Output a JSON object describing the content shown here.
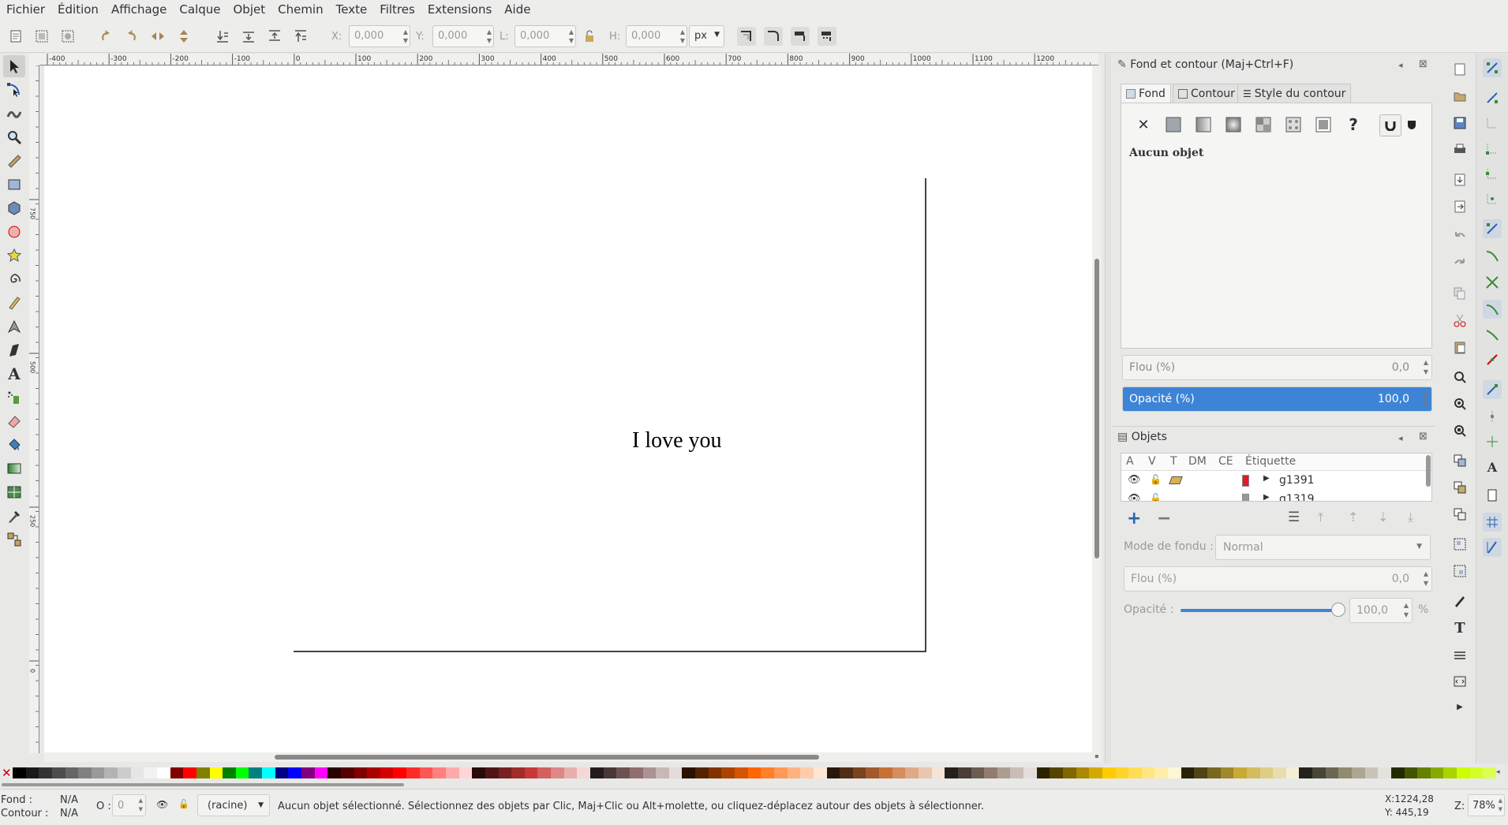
{
  "menu": [
    "Fichier",
    "Édition",
    "Affichage",
    "Calque",
    "Objet",
    "Chemin",
    "Texte",
    "Filtres",
    "Extensions",
    "Aide"
  ],
  "toolbar": {
    "x_label": "X:",
    "x_value": "0,000",
    "y_label": "Y:",
    "y_value": "0,000",
    "w_label": "L:",
    "w_value": "0,000",
    "h_label": "H:",
    "h_value": "0,000",
    "unit": "px"
  },
  "ruler": {
    "h_ticks": [
      "-400",
      "-300",
      "-200",
      "-100",
      "0",
      "100",
      "200",
      "300",
      "400",
      "500",
      "600",
      "700",
      "800",
      "900",
      "1000",
      "1100",
      "1200"
    ],
    "v_ticks": [
      "750",
      "500",
      "250",
      "0"
    ]
  },
  "canvas": {
    "text": "I love you"
  },
  "fill_stroke": {
    "title": "Fond et contour (Maj+Ctrl+F)",
    "tabs": [
      "Fond",
      "Contour",
      "Style du contour"
    ],
    "no_object": "Aucun objet",
    "blur_label": "Flou (%)",
    "blur_value": "0,0",
    "opacity_label": "Opacité (%)",
    "opacity_value": "100,0",
    "opacity_fraction": 1.0
  },
  "objects": {
    "title": "Objets",
    "columns": [
      "A",
      "V",
      "T",
      "DM",
      "CE",
      "Étiquette"
    ],
    "rows": [
      {
        "label": "g1391",
        "color": "#e01b24"
      },
      {
        "label": "g1319",
        "color": "#999999"
      }
    ],
    "blend_label": "Mode de fondu :",
    "blend_value": "Normal",
    "blur_label": "Flou (%)",
    "blur_value": "0,0",
    "opacity_label": "Opacité :",
    "opacity_value": "100,0",
    "opacity_unit": "%",
    "opacity_fraction": 1.0
  },
  "status": {
    "fill_label": "Fond :",
    "fill_value": "N/A",
    "stroke_label": "Contour :",
    "stroke_value": "N/A",
    "o_label": "O :",
    "o_value": "0",
    "layer": "(racine)",
    "message": "Aucun objet sélectionné. Sélectionnez des objets par Clic, Maj+Clic ou Alt+molette, ou cliquez-déplacez autour des objets à sélectionner.",
    "x_coord": "X:1224,28",
    "y_coord": "Y: 445,19",
    "zoom_label": "Z:",
    "zoom": "78%"
  },
  "palette": [
    "#000000",
    "#1a1a1a",
    "#333333",
    "#4d4d4d",
    "#666666",
    "#808080",
    "#999999",
    "#b3b3b3",
    "#cccccc",
    "#e6e6e6",
    "#f2f2f2",
    "#ffffff",
    "#800000",
    "#ff0000",
    "#808000",
    "#ffff00",
    "#008000",
    "#00ff00",
    "#008080",
    "#00ffff",
    "#000080",
    "#0000ff",
    "#800080",
    "#ff00ff",
    "#2b0000",
    "#550000",
    "#800000",
    "#aa0000",
    "#d40000",
    "#ff0000",
    "#ff2a2a",
    "#ff5555",
    "#ff8080",
    "#ffaaaa",
    "#ffd5d5",
    "#280b0b",
    "#501616",
    "#782121",
    "#a02c2c",
    "#c83737",
    "#d35f5f",
    "#de8787",
    "#e9afaf",
    "#f4d7d7",
    "#241c1c",
    "#483737",
    "#6c5353",
    "#916f6f",
    "#ac9393",
    "#c8b7b7",
    "#e3dbdb",
    "#2b1100",
    "#552200",
    "#803300",
    "#aa4400",
    "#d45500",
    "#ff6600",
    "#ff7f2a",
    "#ff9955",
    "#ffb380",
    "#ffccaa",
    "#ffe6d5",
    "#28170b",
    "#502d16",
    "#784421",
    "#a05a2c",
    "#c87137",
    "#d38d5f",
    "#deaa87",
    "#e9c6af",
    "#f4e3d7",
    "#241f1c",
    "#483e37",
    "#6c5d53",
    "#917c6f",
    "#ac9d93",
    "#c8beb7",
    "#e3dedb",
    "#2b2200",
    "#554400",
    "#806600",
    "#aa8800",
    "#d4aa00",
    "#ffcc00",
    "#ffd42a",
    "#ffdd55",
    "#ffe680",
    "#ffeeaa",
    "#fff6d5",
    "#28220b",
    "#504416",
    "#786721",
    "#a0892c",
    "#c8ab37",
    "#d3bc5f",
    "#decd87",
    "#e9ddaf",
    "#f4eed7",
    "#24221c",
    "#484537",
    "#6c6753",
    "#918a6f",
    "#aca793",
    "#c8c4b7",
    "#e3e2db",
    "#222b00",
    "#445500",
    "#668000",
    "#88aa00",
    "#aad400",
    "#ccff00",
    "#d4ff2a",
    "#ddff55"
  ]
}
